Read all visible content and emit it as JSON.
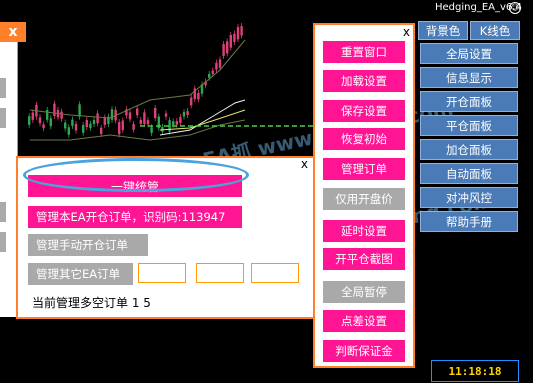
{
  "window": {
    "title": "Hedging_EA_v6.4",
    "close_symbol": "x",
    "clock": "11:18:18"
  },
  "colors": {
    "accent_orange": "#ff7f2a",
    "pink_button": "#ff1493",
    "gray_button": "#a9a9a9",
    "blue_button": "#4a7bb7",
    "highlight_ellipse": "#4aa3df",
    "clock_text": "#ffd700"
  },
  "popup": {
    "close_label": "x",
    "one_click_manage": "一键统管",
    "manage_this_ea": "管理本EA开仓订单，识别码:113947",
    "manage_manual": "管理手动开仓订单",
    "manage_other_ea": "管理其它EA订单",
    "status": "当前管理多空订单 1 5"
  },
  "middle_panel": {
    "close_label": "x",
    "buttons": [
      {
        "label": "重置窗口",
        "state": "active"
      },
      {
        "label": "加载设置",
        "state": "active"
      },
      {
        "label": "保存设置",
        "state": "active"
      },
      {
        "label": "恢复初始",
        "state": "active"
      },
      {
        "label": "管理订单",
        "state": "active"
      },
      {
        "label": "仅用开盘价",
        "state": "disabled"
      },
      {
        "label": "延时设置",
        "state": "active"
      },
      {
        "label": "开平仓截图",
        "state": "active"
      },
      {
        "label": "全局暂停",
        "state": "disabled"
      },
      {
        "label": "点差设置",
        "state": "active"
      },
      {
        "label": "判断保证金",
        "state": "active"
      }
    ]
  },
  "right_panel": {
    "bg_color_label": "背景色",
    "candle_color_label": "K线色",
    "buttons": [
      "全局设置",
      "信息显示",
      "开仓面板",
      "平仓面板",
      "加仓面板",
      "自动面板",
      "对冲风控",
      "帮助手册"
    ]
  },
  "watermark": [
    "EA抓 www.eabang.com",
    "EA抓 www.eabang.com",
    "EA抓 www.eabang.com",
    "EA抓 www.eabang.com"
  ]
}
